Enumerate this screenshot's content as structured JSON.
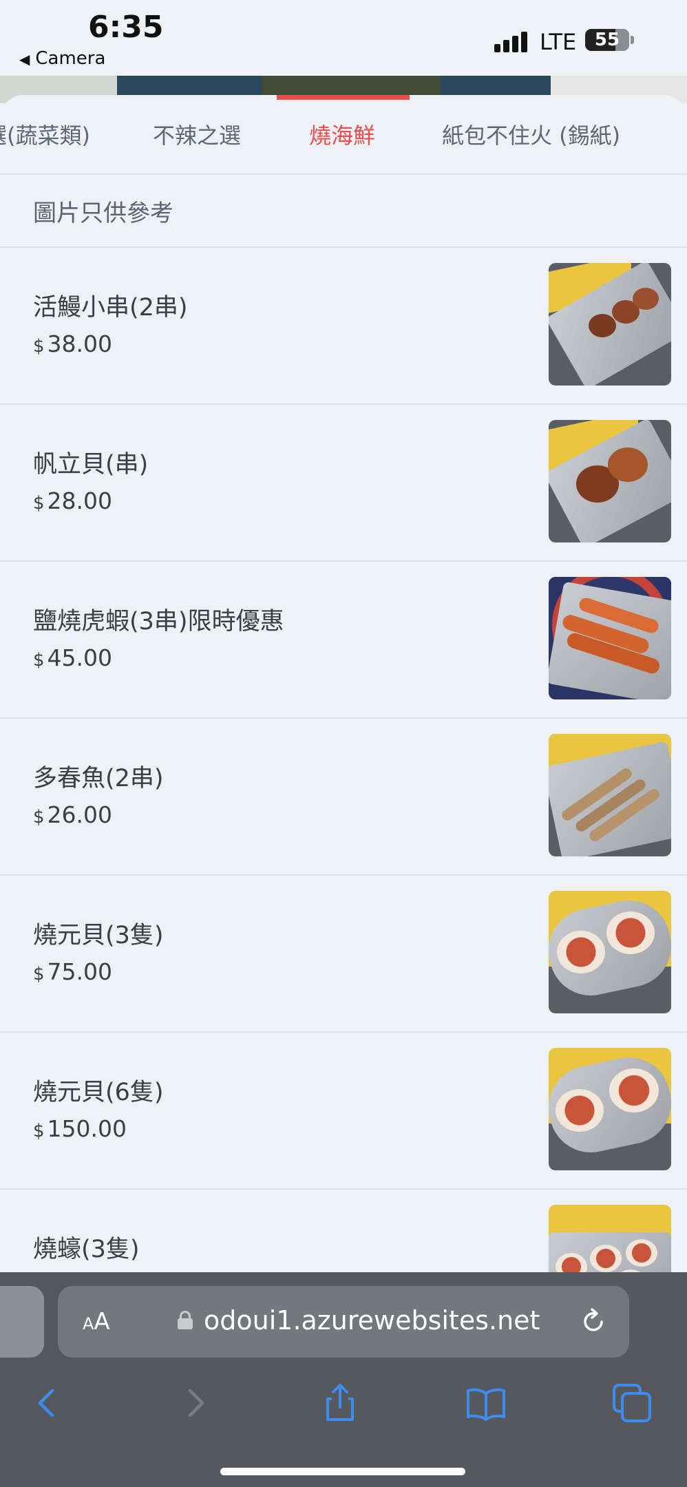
{
  "status_bar": {
    "time": "6:35",
    "back_app": "Camera",
    "network": "LTE",
    "battery": "55"
  },
  "tabs": [
    {
      "label": "選(蔬菜類)",
      "active": false
    },
    {
      "label": "不辣之選",
      "active": false
    },
    {
      "label": "燒海鮮",
      "active": true
    },
    {
      "label": "紙包不住火 (錫紙)",
      "active": false
    }
  ],
  "note": "圖片只供參考",
  "currency": "$",
  "items": [
    {
      "name": "活鰻小串(2串)",
      "price": "38.00"
    },
    {
      "name": "帆立貝(串)",
      "price": "28.00"
    },
    {
      "name": "鹽燒虎蝦(3串)限時優惠",
      "price": "45.00"
    },
    {
      "name": "多春魚(2串)",
      "price": "26.00"
    },
    {
      "name": "燒元貝(3隻)",
      "price": "75.00"
    },
    {
      "name": "燒元貝(6隻)",
      "price": "150.00"
    },
    {
      "name": "燒蠔(3隻)",
      "price": ""
    }
  ],
  "browser": {
    "aa_label": "AA",
    "url": "odoui1.azurewebsites.net"
  },
  "colors": {
    "accent": "#ec4e4b",
    "background": "#eef1f5",
    "toolbar": "#55595e",
    "ios_blue": "#3d8cf2"
  }
}
